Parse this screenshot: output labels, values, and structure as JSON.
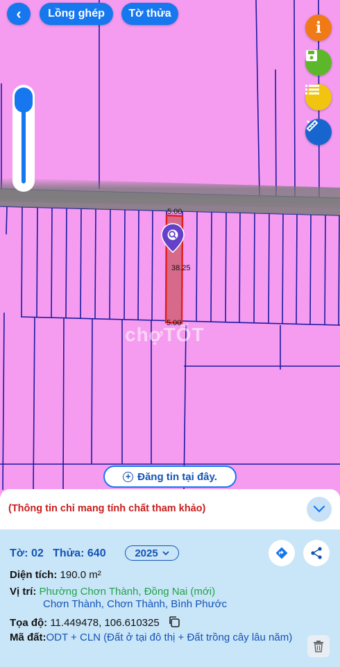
{
  "top_bar": {
    "back_glyph": "‹",
    "long_ghep": "Lồng ghép",
    "to_thua": "Tờ thửa"
  },
  "side_tools": {
    "info_glyph": "i",
    "icons": [
      "info-icon",
      "save-icon",
      "list-icon",
      "ruler-pencil-icon"
    ]
  },
  "map": {
    "parcel_width_top": "5.00",
    "parcel_length": "38.25",
    "parcel_width_bottom": "5.00",
    "watermark": "chợTỐT",
    "colors": {
      "land": "#f59cf0",
      "road": "#7d7d7d",
      "highlight": "#e02020",
      "line": "#1a1aa0"
    }
  },
  "post_button": {
    "label": "Đăng tin tại đây."
  },
  "notice": {
    "text": "(Thông tin chỉ mang tính chất tham khảo)"
  },
  "info": {
    "to_label": "Tờ:",
    "to_value": "02",
    "thua_label": "Thửa:",
    "thua_value": "640",
    "year": "2025",
    "area_label": "Diện tích:",
    "area_value": "190.0 m²",
    "location_label": "Vị trí:",
    "location_new": "Phường Chơn Thành, Đồng Nai (mới)",
    "location_old": "Chơn Thành, Chơn Thành, Bình Phước",
    "coord_label": "Tọa độ:",
    "coord_value": "11.449478, 106.610325",
    "landuse_label": "Mã đất:",
    "landuse_value": "ODT + CLN (Đất ở tại đô thị + Đất trồng cây lâu năm)"
  }
}
